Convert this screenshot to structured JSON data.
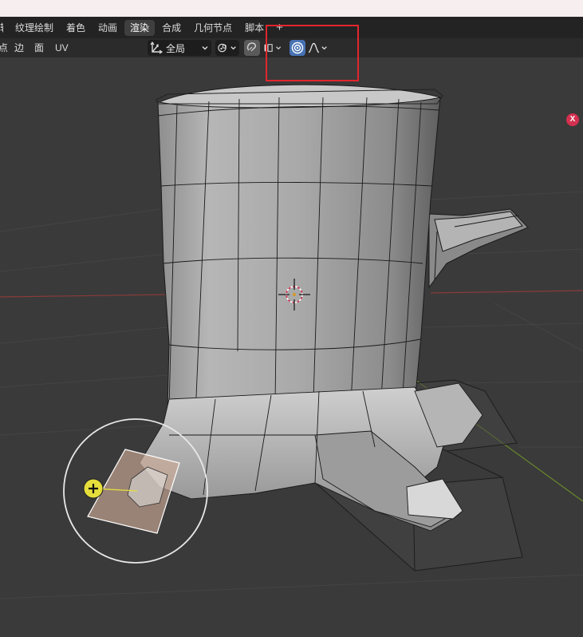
{
  "workspace_tabs": [
    {
      "label": "辑",
      "active": false,
      "partial": true
    },
    {
      "label": "纹理绘制",
      "active": false
    },
    {
      "label": "着色",
      "active": false
    },
    {
      "label": "动画",
      "active": false
    },
    {
      "label": "渲染",
      "active": true
    },
    {
      "label": "合成",
      "active": false
    },
    {
      "label": "几何节点",
      "active": false
    },
    {
      "label": "脚本",
      "active": false
    }
  ],
  "workspace_add": "+",
  "header": {
    "menus": [
      "点",
      "边",
      "面",
      "UV"
    ],
    "orientation_label": "全局"
  },
  "viewport": {
    "axis_x_label": "X"
  },
  "colors": {
    "accent_blue": "#4772b3",
    "axis_x": "#d4304f",
    "axis_y": "#6a8a2a",
    "highlight": "#e2262d",
    "brush_handle": "#e5de3c"
  }
}
